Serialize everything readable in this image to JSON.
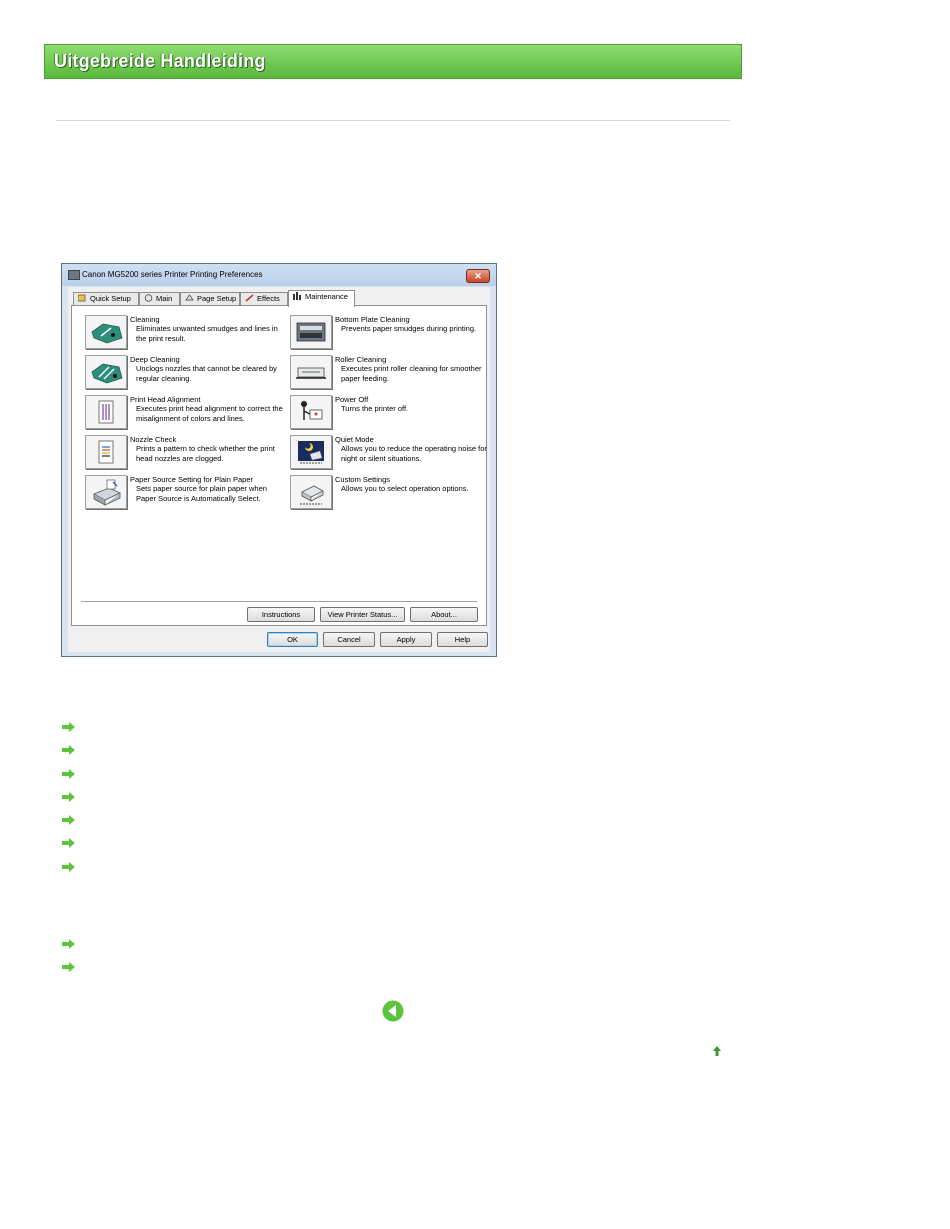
{
  "header": {
    "title": "Uitgebreide Handleiding"
  },
  "dialog": {
    "title": "Canon MG5200 series Printer Printing Preferences",
    "close_label": "✕",
    "tabs": [
      {
        "label": "Quick Setup"
      },
      {
        "label": "Main"
      },
      {
        "label": "Page Setup"
      },
      {
        "label": "Effects"
      },
      {
        "label": "Maintenance"
      }
    ],
    "items": [
      {
        "name": "Cleaning",
        "desc": "Eliminates unwanted smudges and lines in the print result.",
        "icon": "cleaning-icon"
      },
      {
        "name": "Bottom Plate Cleaning",
        "desc": "Prevents paper smudges during printing.",
        "icon": "bottom-plate-cleaning-icon"
      },
      {
        "name": "Deep Cleaning",
        "desc": "Unclogs nozzles that cannot be cleared by regular cleaning.",
        "icon": "deep-cleaning-icon"
      },
      {
        "name": "Roller Cleaning",
        "desc": "Executes print roller cleaning for smoother paper feeding.",
        "icon": "roller-cleaning-icon"
      },
      {
        "name": "Print Head Alignment",
        "desc": "Executes print head alignment to correct the misalignment of colors and lines.",
        "icon": "print-head-alignment-icon"
      },
      {
        "name": "Power Off",
        "desc": "Turns the printer off.",
        "icon": "power-off-icon"
      },
      {
        "name": "Nozzle Check",
        "desc": "Prints a pattern to check whether the print head nozzles are clogged.",
        "icon": "nozzle-check-icon"
      },
      {
        "name": "Quiet Mode",
        "desc": "Allows you to reduce the operating noise for night or silent situations.",
        "icon": "quiet-mode-icon"
      },
      {
        "name": "Paper Source Setting for Plain Paper",
        "desc": "Sets paper source for plain paper when Paper Source is Automatically Select.",
        "icon": "paper-source-icon"
      },
      {
        "name": "Custom Settings",
        "desc": "Allows you to select operation options.",
        "icon": "custom-settings-icon"
      }
    ],
    "panel_buttons": {
      "instructions": "Instructions",
      "view_status": "View Printer Status...",
      "about": "About..."
    },
    "buttons": {
      "ok": "OK",
      "cancel": "Cancel",
      "apply": "Apply",
      "help": "Help"
    }
  },
  "links": {
    "group1_count_icons": "arrow-right-icon",
    "back_icon": "back-arrow-icon",
    "top_icon": "page-top-icon"
  },
  "colors": {
    "header_green": "#58b83c",
    "arrow_green": "#5cc43a",
    "dialog_frame": "#d9e4f1"
  }
}
